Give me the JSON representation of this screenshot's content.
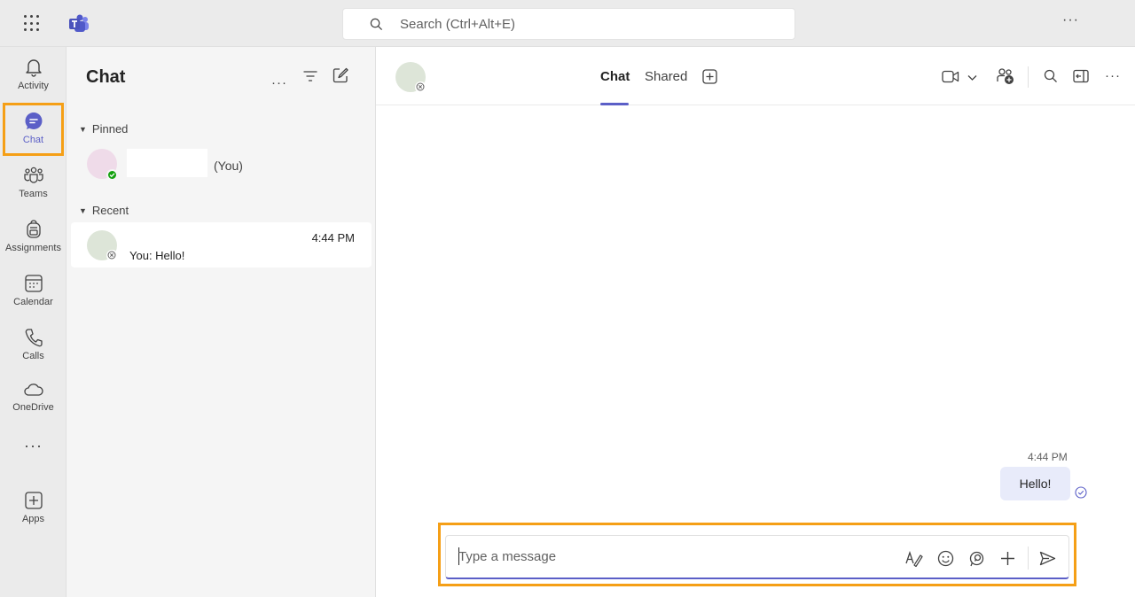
{
  "search": {
    "placeholder": "Search (Ctrl+Alt+E)"
  },
  "rail": {
    "items": [
      {
        "label": "Activity",
        "icon": "bell-icon"
      },
      {
        "label": "Chat",
        "icon": "chat-icon"
      },
      {
        "label": "Teams",
        "icon": "teams-icon"
      },
      {
        "label": "Assignments",
        "icon": "backpack-icon"
      },
      {
        "label": "Calendar",
        "icon": "calendar-icon"
      },
      {
        "label": "Calls",
        "icon": "phone-icon"
      },
      {
        "label": "OneDrive",
        "icon": "cloud-icon"
      },
      {
        "label": "Apps",
        "icon": "add-box-icon"
      }
    ],
    "more": "···"
  },
  "chatlist": {
    "title": "Chat",
    "pinned_label": "Pinned",
    "pinned_you": "(You)",
    "recent_label": "Recent",
    "recent_time": "4:44 PM",
    "recent_preview": "You: Hello!"
  },
  "conversation": {
    "tabs": [
      {
        "label": "Chat"
      },
      {
        "label": "Shared"
      }
    ],
    "message": {
      "time": "4:44 PM",
      "text": "Hello!"
    }
  },
  "compose": {
    "placeholder": "Type a message"
  },
  "colors": {
    "accent": "#5b5fc7",
    "highlight": "#f59f16",
    "bubble": "#e8ebfa",
    "online": "#13a10e"
  }
}
